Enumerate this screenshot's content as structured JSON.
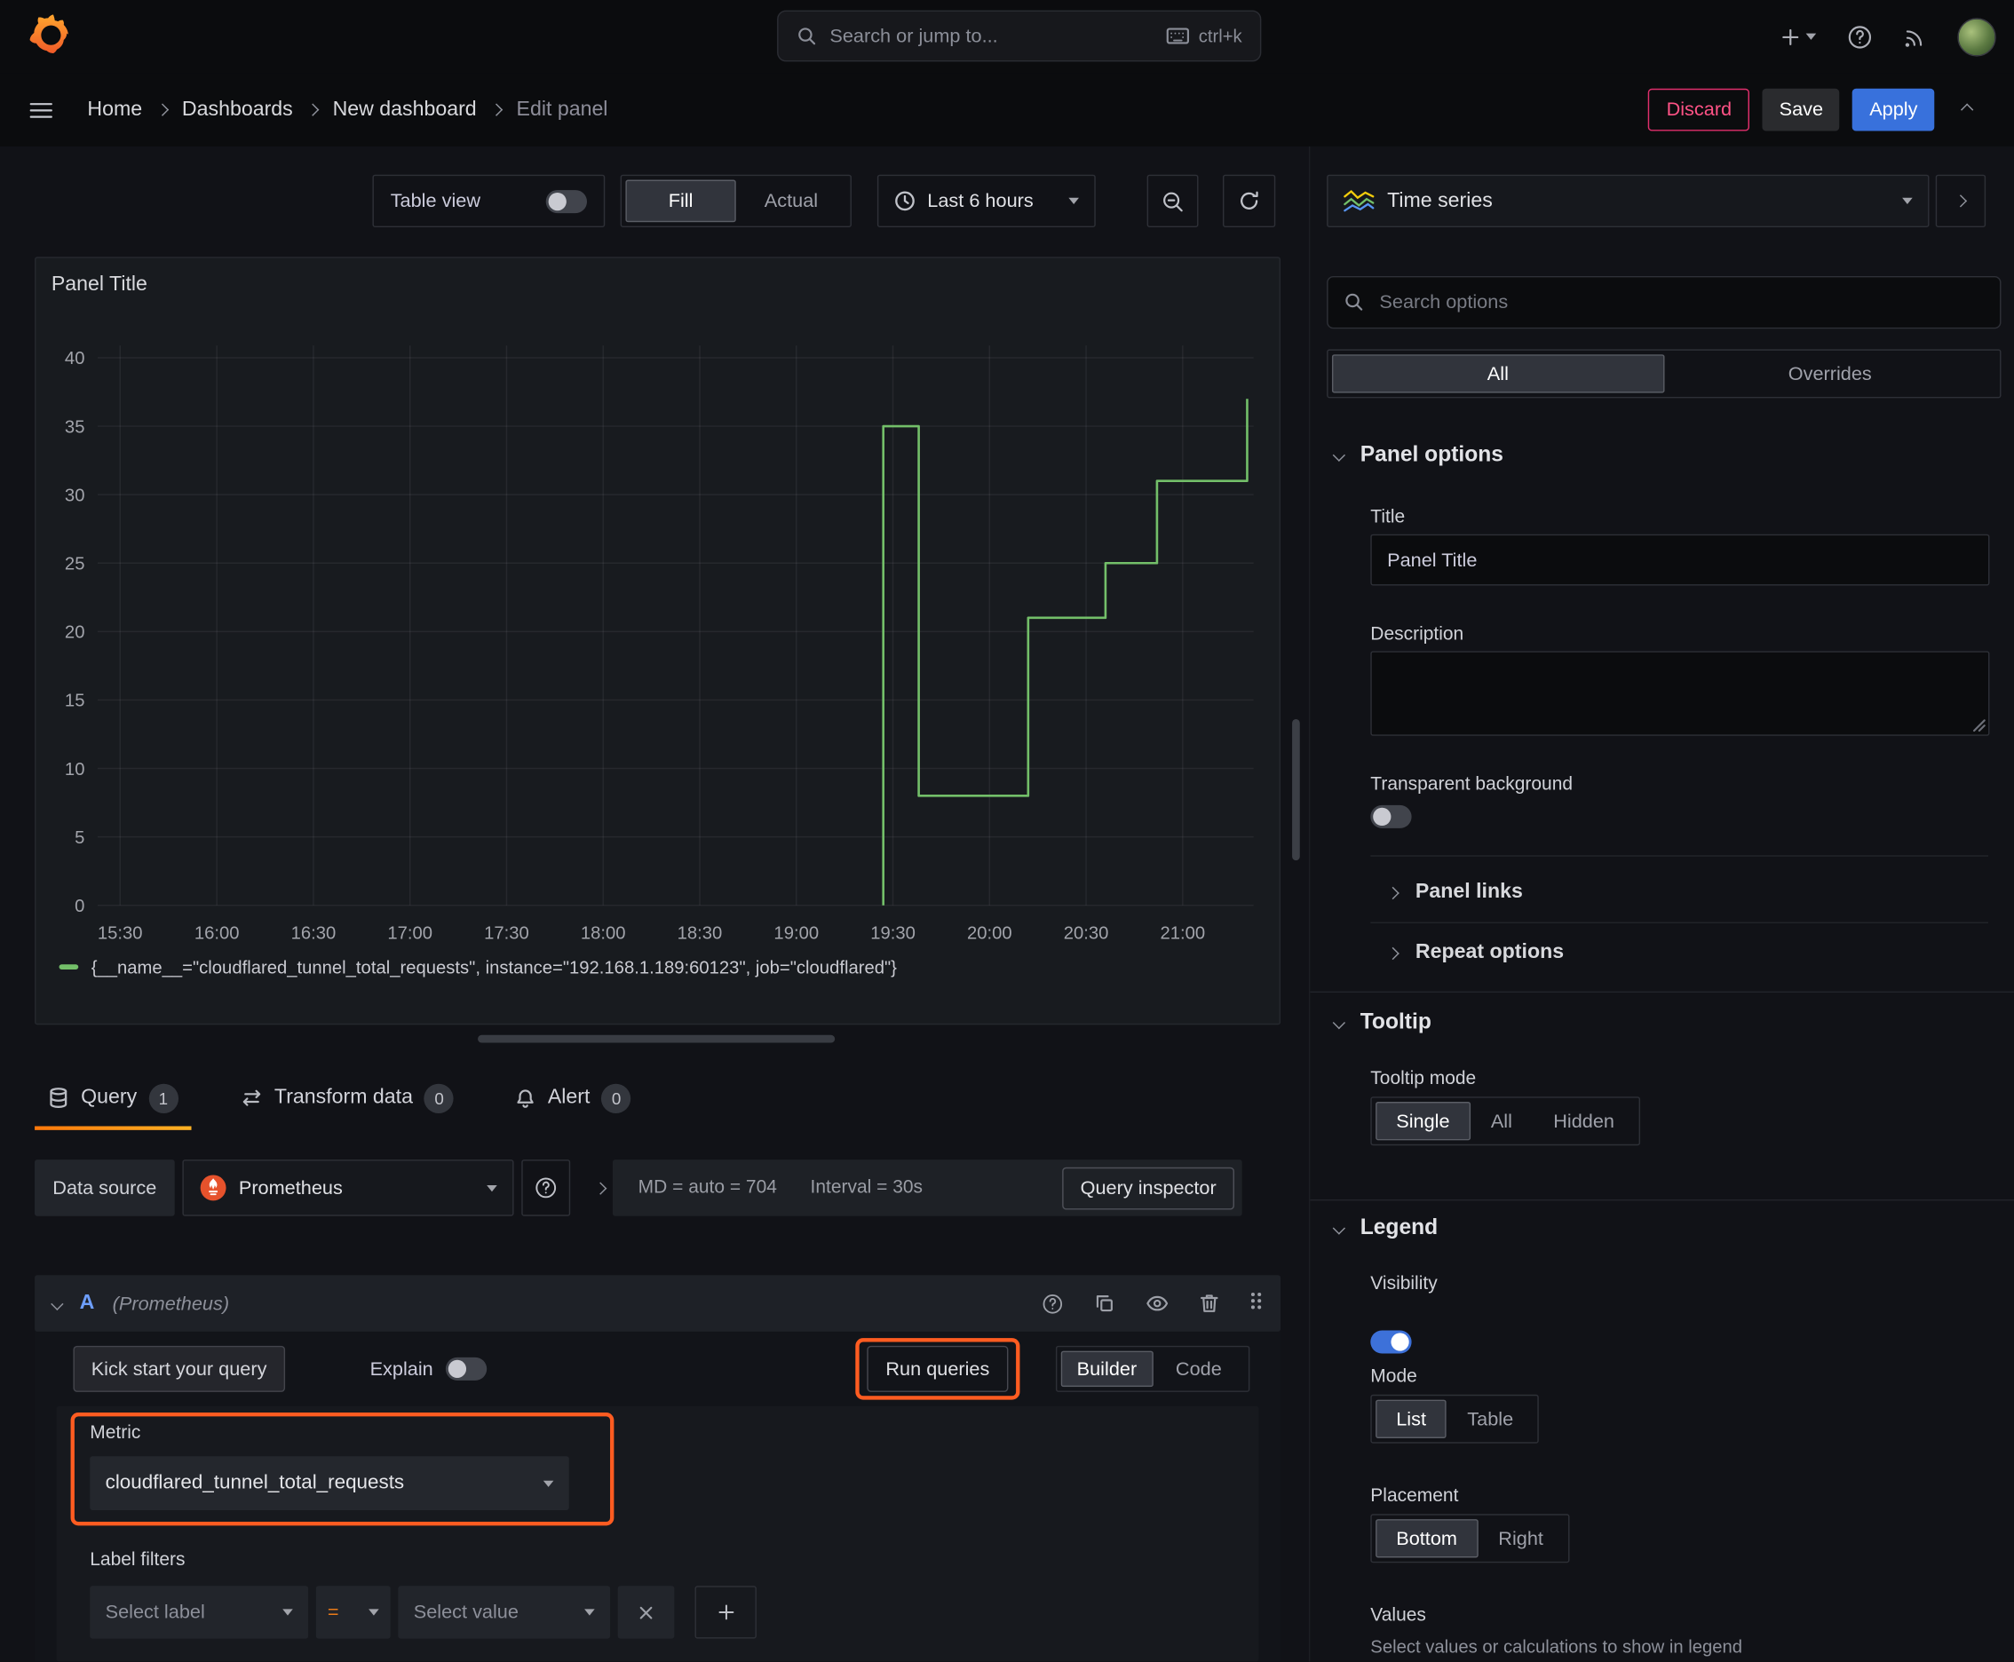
{
  "accent_colors": {
    "orange": "#ff780a",
    "blue": "#3871dc",
    "green": "#73bf69",
    "red": "#ff5286",
    "highlight": "#ff5c21"
  },
  "topnav": {
    "search_placeholder": "Search or jump to...",
    "shortcut": "ctrl+k"
  },
  "breadcrumbs": {
    "items": [
      "Home",
      "Dashboards",
      "New dashboard",
      "Edit panel"
    ]
  },
  "actions": {
    "discard": "Discard",
    "save": "Save",
    "apply": "Apply"
  },
  "toolbar": {
    "table_view": "Table view",
    "fill": "Fill",
    "actual": "Actual",
    "time_range": "Last 6 hours"
  },
  "panel": {
    "title": "Panel Title"
  },
  "chart_data": {
    "type": "line",
    "title": "Panel Title",
    "x_ticks": [
      "15:30",
      "16:00",
      "16:30",
      "17:00",
      "17:30",
      "18:00",
      "18:30",
      "19:00",
      "19:30",
      "20:00",
      "20:30",
      "21:00"
    ],
    "y_ticks": [
      0,
      5,
      10,
      15,
      20,
      25,
      30,
      35,
      40
    ],
    "xlim": [
      "15:23",
      "21:22"
    ],
    "ylim": [
      0,
      40.9
    ],
    "grid": true,
    "legend_position": "bottom",
    "series": [
      {
        "name": "{__name__=\"cloudflared_tunnel_total_requests\", instance=\"192.168.1.189:60123\", job=\"cloudflared\"}",
        "color": "#73bf69",
        "step": true,
        "points": [
          [
            "19:27",
            0
          ],
          [
            "19:27",
            35
          ],
          [
            "19:38",
            35
          ],
          [
            "19:38",
            8
          ],
          [
            "20:12",
            8
          ],
          [
            "20:12",
            21
          ],
          [
            "20:36",
            21
          ],
          [
            "20:36",
            25
          ],
          [
            "20:52",
            25
          ],
          [
            "20:52",
            31
          ],
          [
            "21:20",
            31
          ],
          [
            "21:20",
            37
          ]
        ]
      }
    ]
  },
  "tabs": [
    {
      "label": "Query",
      "count": "1"
    },
    {
      "label": "Transform data",
      "count": "0"
    },
    {
      "label": "Alert",
      "count": "0"
    }
  ],
  "query": {
    "data_source_label": "Data source",
    "data_source_value": "Prometheus",
    "stats_md": "MD = auto = 704",
    "stats_interval": "Interval = 30s",
    "query_inspector": "Query inspector",
    "row_ref": "A",
    "row_datasource": "(Prometheus)",
    "kick_start": "Kick start your query",
    "explain": "Explain",
    "run_queries": "Run queries",
    "builder": "Builder",
    "code": "Code",
    "metric_label": "Metric",
    "metric_value": "cloudflared_tunnel_total_requests",
    "label_filters": "Label filters",
    "select_label": "Select label",
    "operator": "=",
    "select_value": "Select value"
  },
  "sidebar": {
    "viz_type": "Time series",
    "search_placeholder": "Search options",
    "tabs": {
      "all": "All",
      "overrides": "Overrides"
    },
    "panel_options": {
      "header": "Panel options",
      "title_label": "Title",
      "title_value": "Panel Title",
      "description_label": "Description",
      "transparent_label": "Transparent background",
      "panel_links": "Panel links",
      "repeat_options": "Repeat options"
    },
    "tooltip": {
      "header": "Tooltip",
      "mode_label": "Tooltip mode",
      "modes": [
        "Single",
        "All",
        "Hidden"
      ],
      "selected": "Single"
    },
    "legend": {
      "header": "Legend",
      "visibility_label": "Visibility",
      "mode_label": "Mode",
      "modes": [
        "List",
        "Table"
      ],
      "mode_selected": "List",
      "placement_label": "Placement",
      "placements": [
        "Bottom",
        "Right"
      ],
      "placement_selected": "Bottom",
      "values_label": "Values",
      "values_help": "Select values or calculations to show in legend"
    }
  }
}
